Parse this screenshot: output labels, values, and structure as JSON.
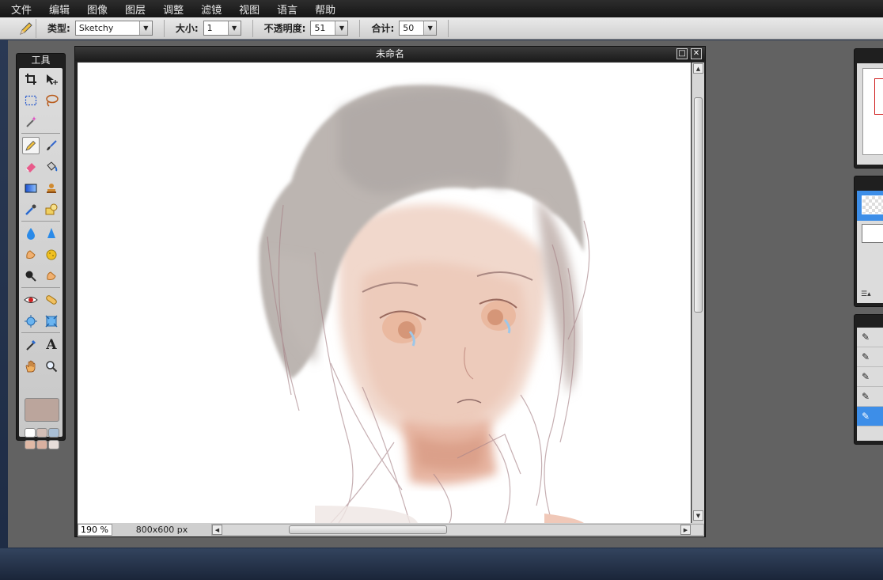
{
  "menu": [
    "文件",
    "编辑",
    "图像",
    "图层",
    "调整",
    "滤镜",
    "视图",
    "语言",
    "帮助"
  ],
  "options": {
    "type_label": "类型:",
    "type_value": "Sketchy",
    "size_label": "大小:",
    "size_value": "1",
    "opacity_label": "不透明度:",
    "opacity_value": "51",
    "total_label": "合计:",
    "total_value": "50"
  },
  "tools_panel": {
    "title": "工具"
  },
  "document": {
    "title": "未命名",
    "zoom": "190",
    "zoom_unit": "%",
    "dimensions": "800x600 px"
  },
  "colors": {
    "primary": "#bba59c",
    "swatches": [
      "#ffffff",
      "#d4bfb7",
      "#a9bfd6",
      "#e0b9a6",
      "#d8b0a0",
      "#e6ddd9"
    ],
    "selection": "#3d8ee8"
  },
  "icons": [
    "pencil-icon",
    "crop-icon",
    "move-icon",
    "marquee-icon",
    "lasso-icon",
    "magic-wand-icon",
    "brush-icon",
    "eraser-icon",
    "bucket-icon",
    "gradient-icon",
    "stamp-icon",
    "colorpicker-icon",
    "shape-icon",
    "drop-icon",
    "sharpen-icon",
    "smudge-icon",
    "sponge-icon",
    "burn-icon",
    "dodge-icon",
    "redeye-icon",
    "bandage-icon",
    "bloat-icon",
    "pinch-icon",
    "eyedropper-icon",
    "text-icon",
    "hand-icon",
    "zoom-icon"
  ]
}
